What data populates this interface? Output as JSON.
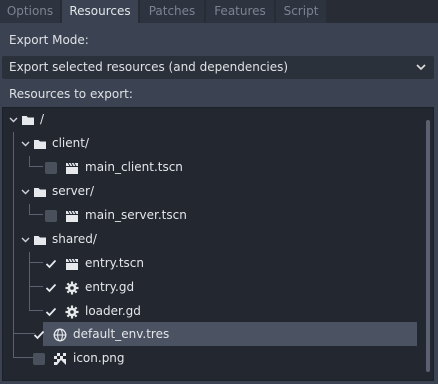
{
  "tabs": [
    {
      "label": "Options",
      "active": false
    },
    {
      "label": "Resources",
      "active": true
    },
    {
      "label": "Patches",
      "active": false
    },
    {
      "label": "Features",
      "active": false
    },
    {
      "label": "Script",
      "active": false
    }
  ],
  "export_mode": {
    "label": "Export Mode:",
    "selected": "Export selected resources (and dependencies)"
  },
  "resources": {
    "label": "Resources to export:",
    "tree": [
      {
        "name": "/",
        "kind": "folder",
        "icon": "folder-icon",
        "expanded": true
      },
      {
        "name": "client/",
        "kind": "folder",
        "icon": "folder-icon",
        "expanded": true
      },
      {
        "name": "main_client.tscn",
        "kind": "scene",
        "icon": "clapperboard-icon",
        "checked": false
      },
      {
        "name": "server/",
        "kind": "folder",
        "icon": "folder-icon",
        "expanded": true
      },
      {
        "name": "main_server.tscn",
        "kind": "scene",
        "icon": "clapperboard-icon",
        "checked": false
      },
      {
        "name": "shared/",
        "kind": "folder",
        "icon": "folder-icon",
        "expanded": true
      },
      {
        "name": "entry.tscn",
        "kind": "scene",
        "icon": "clapperboard-icon",
        "checked": true
      },
      {
        "name": "entry.gd",
        "kind": "script",
        "icon": "gear-icon",
        "checked": true
      },
      {
        "name": "loader.gd",
        "kind": "script",
        "icon": "gear-icon",
        "checked": true
      },
      {
        "name": "default_env.tres",
        "kind": "resource",
        "icon": "globe-icon",
        "checked": true,
        "selected": true
      },
      {
        "name": "icon.png",
        "kind": "image",
        "icon": "image-icon",
        "checked": false
      }
    ]
  },
  "colors": {
    "panel_bg": "#3b4352",
    "tree_bg": "#232830",
    "selection": "#4b5262",
    "text": "#e4e6ea",
    "tab_inactive_text": "#7c8290"
  }
}
